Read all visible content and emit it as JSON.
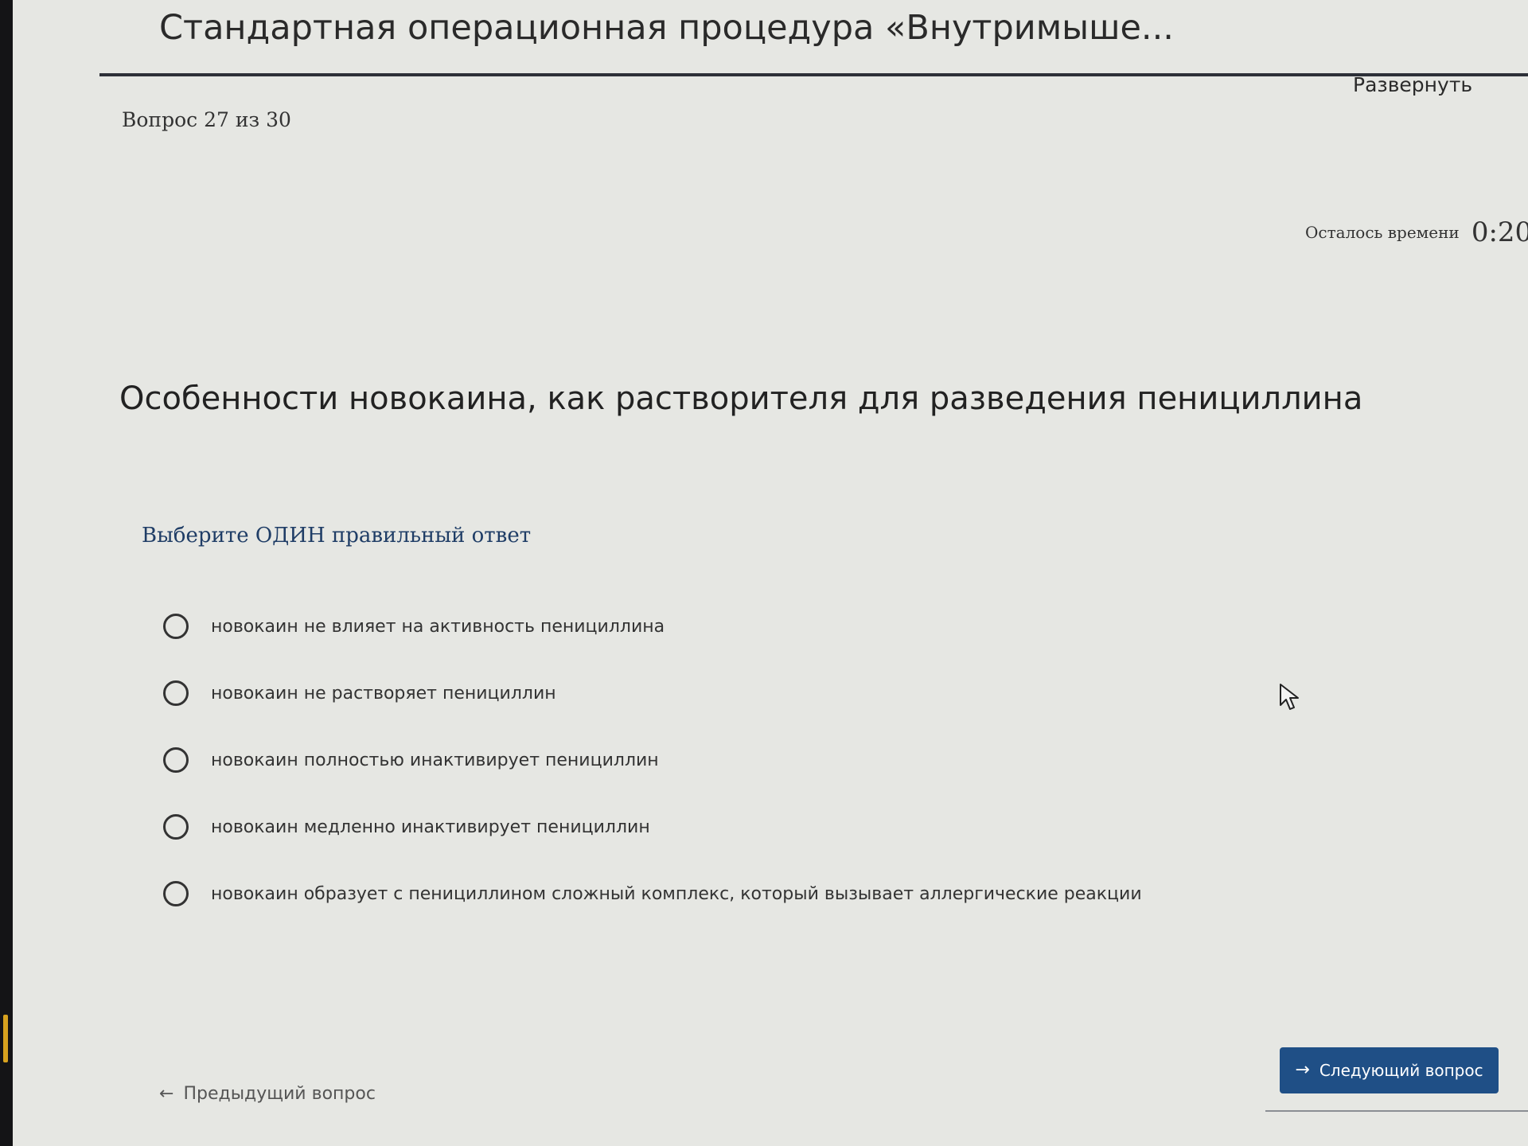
{
  "header": {
    "title": "Стандартная операционная процедура «Внутримыше...",
    "expand_label": "Развернуть"
  },
  "quiz": {
    "counter": "Вопрос 27 из 30",
    "timer_label": "Осталось времени",
    "timer_value": "0:20:",
    "question": "Особенности новокаина, как растворителя для разведения пенициллина",
    "instruction": "Выберите ОДИН правильный ответ",
    "options": [
      {
        "label": "новокаин не влияет на активность пенициллина",
        "selected": false
      },
      {
        "label": "новокаин не растворяет пенициллин",
        "selected": false
      },
      {
        "label": "новокаин полностью инактивирует пенициллин",
        "selected": false
      },
      {
        "label": "новокаин медленно инактивирует пенициллин",
        "selected": false
      },
      {
        "label": "новокаин образует с пенициллином сложный комплекс, который вызывает аллергические реакции",
        "selected": false
      }
    ]
  },
  "nav": {
    "prev_label": "Предыдущий вопрос",
    "prev_icon": "arrow-left-icon",
    "next_label": "Следующий вопрос",
    "next_icon": "arrow-right-icon"
  },
  "colors": {
    "background": "#e6e7e3",
    "primary_button": "#1f4f86",
    "instruction_text": "#1f3d66"
  }
}
